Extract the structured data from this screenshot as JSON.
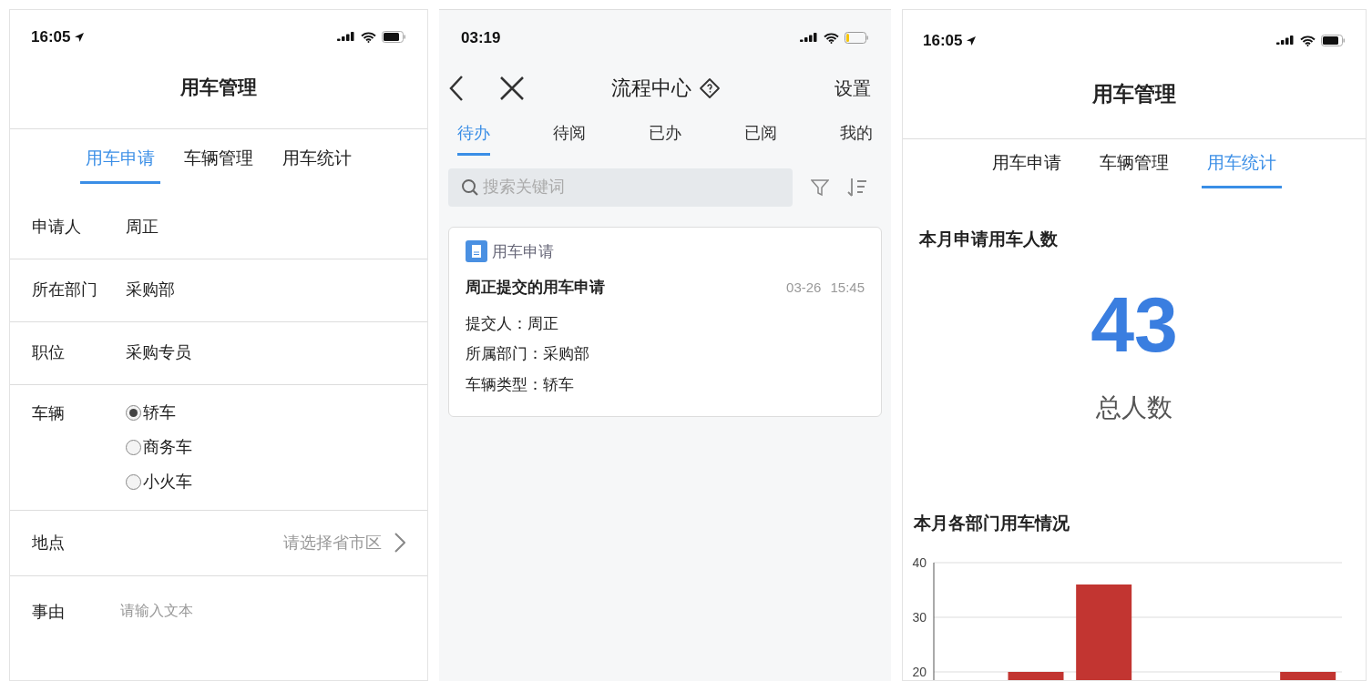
{
  "vehicle_form": {
    "status_bar": {
      "time": "16:05"
    },
    "title": "用车管理",
    "tabs": [
      {
        "label": "用车申请",
        "selected": true
      },
      {
        "label": "车辆管理",
        "selected": false
      },
      {
        "label": "用车统计",
        "selected": false
      }
    ],
    "fields": [
      {
        "kind": "text",
        "label": "申请人",
        "value": "周正"
      },
      {
        "kind": "text",
        "label": "所在部门",
        "value": "采购部"
      },
      {
        "kind": "text",
        "label": "职位",
        "value": "采购专员"
      },
      {
        "kind": "radio",
        "label": "车辆",
        "options": [
          {
            "label": "轿车",
            "selected": true
          },
          {
            "label": "商务车",
            "selected": false
          },
          {
            "label": "小火车",
            "selected": false
          }
        ]
      },
      {
        "kind": "picker",
        "label": "地点",
        "placeholder": "请选择省市区"
      },
      {
        "kind": "textarea",
        "label": "事由",
        "placeholder": "请输入文本"
      }
    ]
  },
  "process_center": {
    "status_bar": {
      "time": "03:19"
    },
    "title": "流程中心",
    "settings": "设置",
    "tabs": [
      {
        "label": "待办",
        "selected": true
      },
      {
        "label": "待阅",
        "selected": false
      },
      {
        "label": "已办",
        "selected": false
      },
      {
        "label": "已阅",
        "selected": false
      },
      {
        "label": "我的",
        "selected": false
      }
    ],
    "search": {
      "placeholder": "搜索关键词"
    },
    "cards": [
      {
        "app": "用车申请",
        "title": "周正提交的用车申请",
        "date": "03-26",
        "time": "15:45",
        "lines": [
          "提交人：周正",
          "所属部门：采购部",
          "车辆类型：轿车"
        ]
      }
    ]
  },
  "vehicle_stats": {
    "status_bar": {
      "time": "16:05"
    },
    "title": "用车管理",
    "tabs": [
      {
        "label": "用车申请",
        "selected": false
      },
      {
        "label": "车辆管理",
        "selected": false
      },
      {
        "label": "用车统计",
        "selected": true
      }
    ],
    "headcount_title": "本月申请用车人数",
    "headcount": "43",
    "headcount_label": "总人数",
    "chart_title": "本月各部门用车情况",
    "chart_data": {
      "type": "bar",
      "ylim": [
        0,
        40
      ],
      "yticks": [
        20,
        30,
        40
      ],
      "series": [
        {
          "color": "#c23531",
          "values": [
            null,
            20,
            36,
            null,
            null,
            20
          ]
        }
      ]
    }
  }
}
